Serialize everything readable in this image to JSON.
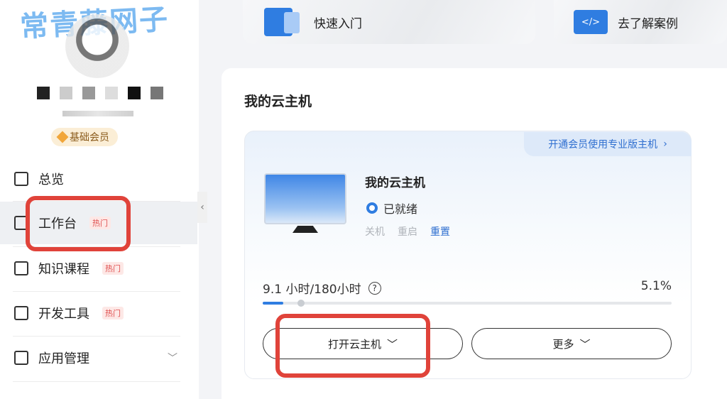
{
  "watermark": "常青藤网子",
  "sidebar": {
    "member_badge": "基础会员",
    "items": [
      {
        "label": "总览",
        "tag": ""
      },
      {
        "label": "工作台",
        "tag": "热门"
      },
      {
        "label": "知识课程",
        "tag": "热门"
      },
      {
        "label": "开发工具",
        "tag": "热门"
      },
      {
        "label": "应用管理",
        "tag": ""
      }
    ]
  },
  "top_cards": {
    "quick_start": "快速入门",
    "learn_cases": "去了解案例",
    "code_icon_text": "</>"
  },
  "main": {
    "section_title": "我的云主机",
    "upsell": "开通会员使用专业版主机",
    "host": {
      "name": "我的云主机",
      "status": "已就绪",
      "actions": [
        "关机",
        "重启",
        "重置"
      ]
    },
    "usage": {
      "label": "9.1 小时/180小时",
      "percent_label": "5.1%",
      "fraction": 0.051
    },
    "buttons": {
      "open_host": "打开云主机",
      "more": "更多"
    }
  },
  "colors": {
    "accent": "#2f7de1",
    "highlight_box": "#e0433a",
    "hot_tag": "#e05050"
  }
}
